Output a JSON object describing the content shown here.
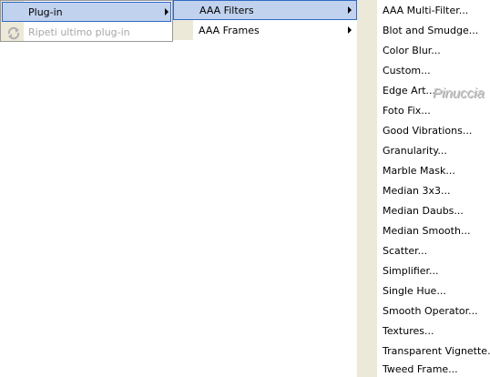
{
  "menu_main": {
    "items": [
      {
        "label": "Plug-in",
        "state": "highlighted",
        "submenu": true
      },
      {
        "label": "Ripeti ultimo plug-in",
        "state": "disabled",
        "icon": "refresh-icon"
      }
    ]
  },
  "menu_plugins": {
    "items": [
      {
        "label": "AAA Filters",
        "state": "highlighted",
        "submenu": true
      },
      {
        "label": "AAA Frames",
        "state": "normal",
        "submenu": true
      }
    ]
  },
  "menu_filters": {
    "items": [
      "AAA Multi-Filter...",
      "Blot and Smudge...",
      "Color Blur...",
      "Custom...",
      "Edge Art...",
      "Foto Fix...",
      "Good Vibrations...",
      "Granularity...",
      "Marble Mask...",
      "Median 3x3...",
      "Median Daubs...",
      "Median Smooth...",
      "Scatter...",
      "Simplifier...",
      "Single Hue...",
      "Smooth Operator...",
      "Textures...",
      "Transparent Vignette...",
      "Tweed Frame..."
    ]
  },
  "watermark": "Pinuccia",
  "colors": {
    "highlight_fill": "#c1d2ee",
    "highlight_border": "#316ac5",
    "gutter": "#ece9d8",
    "disabled_text": "#a7a7a7"
  }
}
